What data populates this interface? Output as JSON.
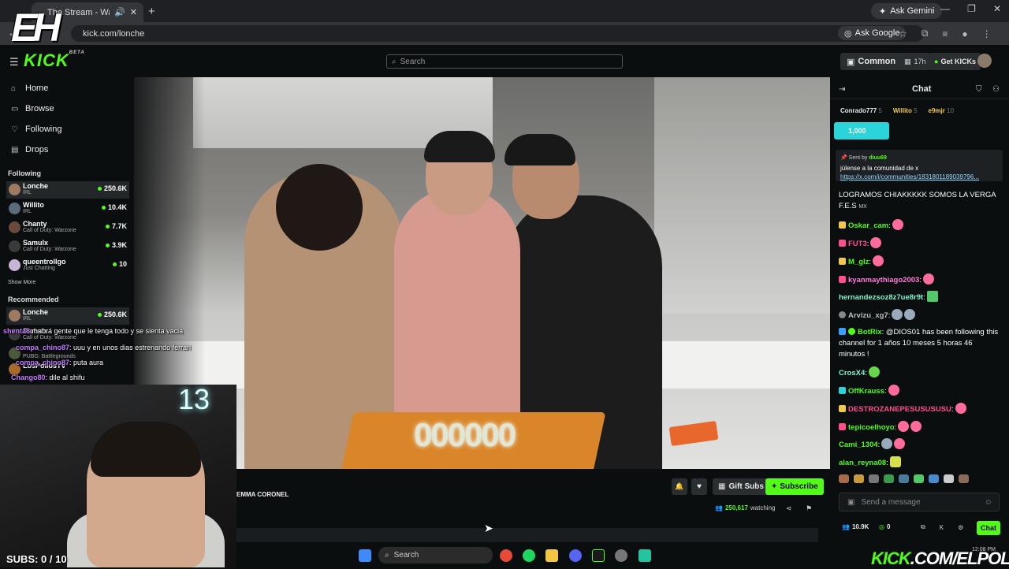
{
  "browser": {
    "tab_title": "The Stream - Watch Live",
    "ask_gemini": "Ask Gemini",
    "url": "kick.com/lonche",
    "ask_google": "Ask Google"
  },
  "header": {
    "logo": "KICK",
    "logo_badge": "BETA",
    "search_placeholder": "Search",
    "common_label": "Common",
    "time_label": "17h",
    "get_kicks_label": "Get KICKs"
  },
  "sidebar": {
    "nav": [
      {
        "label": "Home",
        "icon": "home-icon"
      },
      {
        "label": "Browse",
        "icon": "browse-icon"
      },
      {
        "label": "Following",
        "icon": "heart-icon"
      },
      {
        "label": "Drops",
        "icon": "drops-icon"
      }
    ],
    "following_title": "Following",
    "following": [
      {
        "name": "Lonche",
        "category": "IRL",
        "viewers": "250.6K",
        "color": "#a07a60"
      },
      {
        "name": "Willito",
        "category": "IRL",
        "viewers": "10.4K",
        "color": "#5a6b7a"
      },
      {
        "name": "Chanty",
        "category": "Call of Duty: Warzone",
        "viewers": "7.7K",
        "color": "#6a4a3a"
      },
      {
        "name": "Samulx",
        "category": "Call of Duty: Warzone",
        "viewers": "3.9K",
        "color": "#3a3a3a"
      },
      {
        "name": "queentrollgo",
        "category": "Just Chatting",
        "viewers": "10",
        "color": "#c8b4d6"
      }
    ],
    "show_more": "Show More",
    "recommended_title": "Recommended",
    "recommended": [
      {
        "name": "Lonche",
        "category": "IRL",
        "viewers": "250.6K",
        "color": "#a07a60"
      },
      {
        "name": "Samulx",
        "category": "Call of Duty: Warzone",
        "viewers": "",
        "color": "#3a3a3a"
      },
      {
        "name": "",
        "category": "PUBG: Battlegrounds",
        "viewers": "",
        "color": "#4a5a3a"
      },
      {
        "name": "LosPollosTV",
        "category": "",
        "viewers": "",
        "color": "#aa6a2a"
      }
    ]
  },
  "stream_overlay": {
    "chat": [
      {
        "user": "shenta8",
        "text": ": habrá gente que le tenga todo y se sienta vacia"
      },
      {
        "user": "compa_chino87",
        "text": ": uuu y en unos dias estrenando ferrari"
      },
      {
        "user": "compa_chino87",
        "text": ": puta aura"
      },
      {
        "user": "Chango80",
        "text": ": dile al shifu"
      }
    ],
    "cam_number": "13",
    "subs_goal": "SUBS: 0 / 10",
    "cake_number": "000000"
  },
  "stream_info": {
    "streamer": "EMMA CORONEL",
    "gift_subs": "Gift Subs",
    "subscribe": "Subscribe",
    "viewers": "250,617",
    "watching": "watching"
  },
  "chat": {
    "title": "Chat",
    "top_gifters": [
      {
        "name": "Conrado777",
        "count": "5"
      },
      {
        "name": "Willito",
        "count": "5"
      },
      {
        "name": "e9mjr",
        "count": "10"
      }
    ],
    "kicks_amount": "1,000",
    "pinned": {
      "sent_by_label": "Sent by",
      "user": "diuu69",
      "message": "júlense a la comunidad de x",
      "link": "https://x.com/i/communities/18318011890397​96..."
    },
    "messages": [
      {
        "user": "",
        "text": "LOGRAMOS CHIAKKKKK SOMOS LA VERGA F.E.S",
        "tag": "MX",
        "color": "#ffffff",
        "badge": "",
        "emotes": 0
      },
      {
        "user": "Oskar_cam",
        "text": ":",
        "color": "#53fc18",
        "badge": "#f2c94c",
        "emotes": 1
      },
      {
        "user": "FUT3",
        "text": ":",
        "color": "#ff4d8d",
        "badge": "#ff4d8d",
        "emotes": 1
      },
      {
        "user": "M_glz",
        "text": ":",
        "color": "#53fc18",
        "badge": "#f2c94c",
        "emotes": 1
      },
      {
        "user": "kyanmaythiago2003",
        "text": ":",
        "color": "#ff7ad9",
        "badge": "#ff4d8d",
        "emotes": 1
      },
      {
        "user": "hernandezsoz8z7ue8r9t",
        "text": ":",
        "color": "#7cf5d0",
        "badge": "",
        "emotes": 1
      },
      {
        "user": "Arvizu_xg7",
        "text": ":",
        "color": "#bbbbbb",
        "badge": "#888888",
        "emotes": 2
      },
      {
        "user": "BotRix",
        "text": ": @DIOS01 has been following this channel for 1 años 10 meses 5 horas 46 minutos !",
        "color": "#53fc18",
        "badge": "#3aa0ff",
        "emotes": 0
      },
      {
        "user": "CrosX4",
        "text": ":",
        "color": "#7cf5d0",
        "badge": "",
        "emotes": 1
      },
      {
        "user": "OffKrauss",
        "text": ":",
        "color": "#53fc18",
        "badge": "#2bd4d8",
        "emotes": 1
      },
      {
        "user": "DESTROZANEPESUSUSUSU",
        "text": ":",
        "color": "#ff4d8d",
        "badge": "#f2c94c",
        "emotes": 1
      },
      {
        "user": "tepicoelhoyo",
        "text": ":",
        "color": "#53fc18",
        "badge": "#ff4d8d",
        "emotes": 2
      },
      {
        "user": "Cami_1304",
        "text": ":",
        "color": "#53fc18",
        "badge": "",
        "emotes": 2
      },
      {
        "user": "alan_reyna08",
        "text": ":",
        "color": "#53fc18",
        "badge": "",
        "emotes": 1
      }
    ],
    "send_placeholder": "Send a message",
    "followers": "10.9K",
    "kick_coins": "0",
    "chat_button": "Chat"
  },
  "taskbar": {
    "search": "Search",
    "watermark_kick": "KICK",
    "watermark_channel": ".COM/ELPOLIN",
    "clock": "12:08 PM"
  },
  "colors": {
    "kick_green": "#53fc18",
    "background": "#0b0e0f",
    "panel": "#2a2e31"
  }
}
